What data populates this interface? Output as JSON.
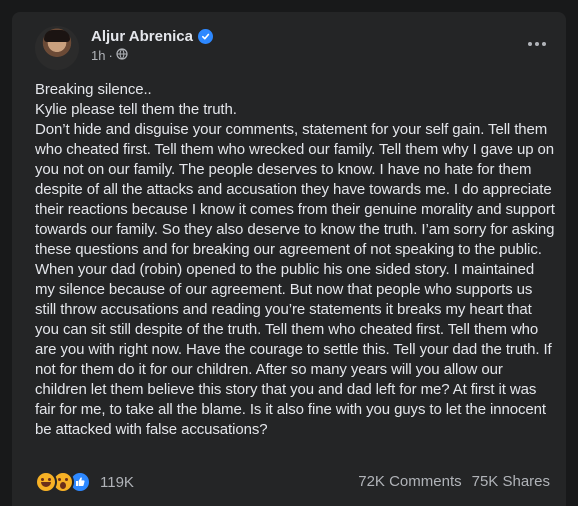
{
  "post": {
    "author": "Aljur Abrenica",
    "time": "1h",
    "audience_icon": "globe-icon",
    "verified_icon": "verified-badge-icon",
    "body": "Breaking silence..\nKylie please tell them the truth.\nDon’t hide and disguise your comments, statement for your self gain. Tell them who cheated first. Tell them who wrecked our family. Tell them why I gave up on you not on our family. The people deserves to know. I have no hate for them despite of all the attacks and accusation they have towards me. I do appreciate their reactions because I know it comes from their genuine morality and support towards our family. So they also deserve to know the truth. I’am sorry for asking these questions and for breaking our agreement of not speaking to the public. When your dad (robin) opened to the public his one sided story. I maintained my silence because of our agreement. But now that people who supports us still throw accusations and reading you’re statements it breaks my heart that you can sit still despite of the truth. Tell them who cheated first. Tell them who are you with right now. Have the courage to settle this. Tell your dad the truth. If not for them do it for our children. After so many years will you allow our children let them believe this story that you and dad left for me? At first it was fair for me, to take all the blame. Is it also fine with you guys to let the innocent be attacked with false accusations?"
  },
  "footer": {
    "reaction_icons": [
      "haha-icon",
      "wow-icon",
      "like-icon"
    ],
    "reaction_count": "119K",
    "comments": "72K Comments",
    "shares": "75K Shares"
  },
  "colors": {
    "background": "#18191a",
    "card": "#242526",
    "text": "#e4e6eb",
    "secondary_text": "#b0b3b8",
    "accent": "#2d88ff"
  }
}
